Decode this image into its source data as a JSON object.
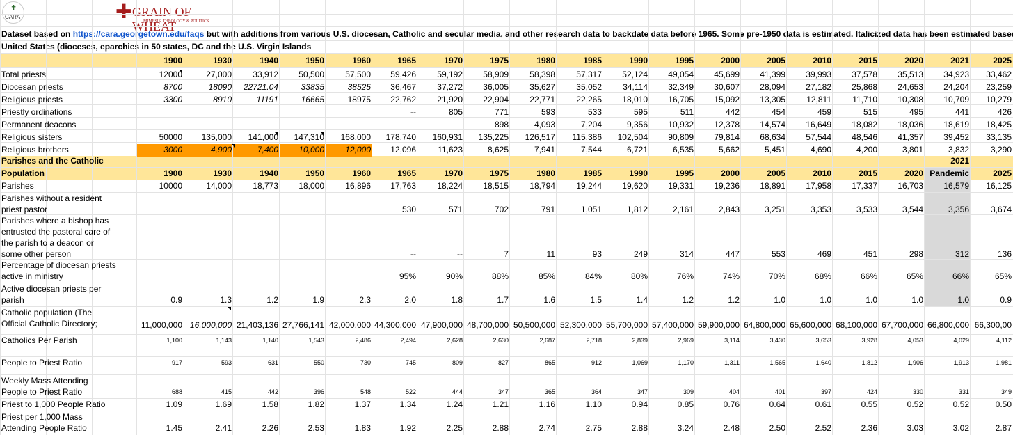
{
  "logos": {
    "cara_text": "CARA",
    "grain_title": "GRAIN OF WHEAT",
    "grain_sub": "MIMESIS, THEOLOGY & POLITICS"
  },
  "header": {
    "line1_pre": "Dataset based on ",
    "line1_link": "https://cara.georgetown.edu/faqs",
    "line1_post": " but with additions from various U.S. diocesan, Catholic and secular media, and other research data to backdate data before 1965. Some pre-1950 data is estimated. Italicized data has been estimated based on various",
    "line2": "United States (dioceses, eparchies in 50 states, DC and the U.S. Virgin Islands"
  },
  "years": [
    "1900",
    "1930",
    "1940",
    "1950",
    "1960",
    "1965",
    "1970",
    "1975",
    "1980",
    "1985",
    "1990",
    "1995",
    "2000",
    "2005",
    "2010",
    "2015",
    "2020",
    "2021",
    "2025"
  ],
  "years2": [
    "1900",
    "1930",
    "1940",
    "1950",
    "1960",
    "1965",
    "1970",
    "1975",
    "1980",
    "1985",
    "1990",
    "1995",
    "2000",
    "2005",
    "2010",
    "2015",
    "2020",
    "Pandemic",
    "2025"
  ],
  "section2": {
    "line1": "Parishes and the Catholic",
    "line2": "Population",
    "col2021": "2021"
  },
  "rows": [
    {
      "label": [
        "Total priests"
      ],
      "values": [
        "12000",
        "27,000",
        "33,912",
        "50,500",
        "57,500",
        "59,426",
        "59,192",
        "58,909",
        "58,398",
        "57,317",
        "52,124",
        "49,054",
        "45,699",
        "41,399",
        "39,993",
        "37,578",
        "35,513",
        "34,923",
        "33,462"
      ],
      "italic": []
    },
    {
      "label": [
        "Diocesan priests"
      ],
      "values": [
        "8700",
        "18090",
        "22721.04",
        "33835",
        "38525",
        "36,467",
        "37,272",
        "36,005",
        "35,627",
        "35,052",
        "34,114",
        "32,349",
        "30,607",
        "28,094",
        "27,182",
        "25,868",
        "24,653",
        "24,204",
        "23,259"
      ],
      "italic": [
        0,
        1,
        2,
        3,
        4
      ]
    },
    {
      "label": [
        "Religious priests"
      ],
      "values": [
        "3300",
        "8910",
        "11191",
        "16665",
        "18975",
        "22,762",
        "21,920",
        "22,904",
        "22,771",
        "22,265",
        "18,010",
        "16,705",
        "15,092",
        "13,305",
        "12,811",
        "11,710",
        "10,308",
        "10,709",
        "10,279"
      ],
      "italic": [
        0,
        1,
        2,
        3
      ]
    },
    {
      "label": [
        "Priestly ordinations"
      ],
      "values": [
        "",
        "",
        "",
        "",
        "",
        "--",
        "805",
        "771",
        "593",
        "533",
        "595",
        "511",
        "442",
        "454",
        "459",
        "515",
        "495",
        "441",
        "426"
      ],
      "italic": []
    },
    {
      "label": [
        "Permanent deacons"
      ],
      "values": [
        "",
        "",
        "",
        "",
        "",
        "",
        "",
        "898",
        "4,093",
        "7,204",
        "9,356",
        "10,932",
        "12,378",
        "14,574",
        "16,649",
        "18,082",
        "18,036",
        "18,619",
        "18,425"
      ],
      "italic": []
    },
    {
      "label": [
        "Religious sisters"
      ],
      "values": [
        "50000",
        "135,000",
        "141,000",
        "147,310",
        "168,000",
        "178,740",
        "160,931",
        "135,225",
        "126,517",
        "115,386",
        "102,504",
        "90,809",
        "79,814",
        "68,634",
        "57,544",
        "48,546",
        "41,357",
        "39,452",
        "33,135"
      ],
      "italic": []
    },
    {
      "label": [
        "Religious brothers"
      ],
      "values": [
        "3000",
        "4,900",
        "7,400",
        "10,000",
        "12,000",
        "12,096",
        "11,623",
        "8,625",
        "7,941",
        "7,544",
        "6,721",
        "6,535",
        "5,662",
        "5,451",
        "4,690",
        "4,200",
        "3,801",
        "3,832",
        "3,290"
      ],
      "italic": [
        0,
        1,
        2,
        3,
        4
      ]
    },
    {
      "label": [
        "Parishes"
      ],
      "values": [
        "10000",
        "14,000",
        "18,773",
        "18,000",
        "16,896",
        "17,763",
        "18,224",
        "18,515",
        "18,794",
        "19,244",
        "19,620",
        "19,331",
        "19,236",
        "18,891",
        "17,958",
        "17,337",
        "16,703",
        "16,579",
        "16,125"
      ],
      "italic": []
    },
    {
      "label": [
        "Parishes without a resident",
        "priest pastor"
      ],
      "values": [
        "",
        "",
        "",
        "",
        "",
        "530",
        "571",
        "702",
        "791",
        "1,051",
        "1,812",
        "2,161",
        "2,843",
        "3,251",
        "3,353",
        "3,533",
        "3,544",
        "3,356",
        "3,674"
      ],
      "italic": []
    },
    {
      "label": [
        "Parishes where a bishop has",
        "entrusted the pastoral care of",
        "the parish to a deacon or",
        "some other person"
      ],
      "values": [
        "",
        "",
        "",
        "",
        "",
        "--",
        "--",
        "7",
        "11",
        "93",
        "249",
        "314",
        "447",
        "553",
        "469",
        "451",
        "298",
        "312",
        "136"
      ],
      "italic": []
    },
    {
      "label": [
        "Percentage of diocesan priests",
        "active in ministry"
      ],
      "values": [
        "",
        "",
        "",
        "",
        "",
        "95%",
        "90%",
        "88%",
        "85%",
        "84%",
        "80%",
        "76%",
        "74%",
        "70%",
        "68%",
        "66%",
        "65%",
        "66%",
        "65%"
      ],
      "italic": []
    },
    {
      "label": [
        "Active diocesan priests per",
        "parish"
      ],
      "values": [
        "0.9",
        "1.3",
        "1.2",
        "1.9",
        "2.3",
        "2.0",
        "1.8",
        "1.7",
        "1.6",
        "1.5",
        "1.4",
        "1.2",
        "1.2",
        "1.0",
        "1.0",
        "1.0",
        "1.0",
        "1.0",
        "0.9"
      ],
      "italic": []
    },
    {
      "label": [
        "Catholic population (The",
        "Official Catholic Directory;"
      ],
      "values": [
        "11,000,000",
        "16,000,000",
        "21,403,136",
        "27,766,141",
        "42,000,000",
        "44,300,000",
        "47,900,000",
        "48,700,000",
        "50,500,000",
        "52,300,000",
        "55,700,000",
        "57,400,000",
        "59,900,000",
        "64,800,000",
        "65,600,000",
        "68,100,000",
        "67,700,000",
        "66,800,000",
        "66,300,00"
      ],
      "italic": [
        1
      ]
    },
    {
      "label": [
        "Catholics Per Parish"
      ],
      "values": [
        "1,100",
        "1,143",
        "1,140",
        "1,543",
        "2,486",
        "2,494",
        "2,628",
        "2,630",
        "2,687",
        "2,718",
        "2,839",
        "2,969",
        "3,114",
        "3,430",
        "3,653",
        "3,928",
        "4,053",
        "4,029",
        "4,112"
      ],
      "italic": []
    },
    {
      "label": [
        "People to Priest Ratio"
      ],
      "values": [
        "917",
        "593",
        "631",
        "550",
        "730",
        "745",
        "809",
        "827",
        "865",
        "912",
        "1,069",
        "1,170",
        "1,311",
        "1,565",
        "1,640",
        "1,812",
        "1,906",
        "1,913",
        "1,981"
      ],
      "italic": []
    },
    {
      "label": [
        "Weekly Mass Attending",
        "People to Priest Ratio"
      ],
      "values": [
        "688",
        "415",
        "442",
        "396",
        "548",
        "522",
        "444",
        "347",
        "365",
        "364",
        "347",
        "309",
        "404",
        "401",
        "397",
        "424",
        "330",
        "331",
        "349"
      ],
      "italic": []
    },
    {
      "label": [
        "Priest to 1,000 People Ratio"
      ],
      "values": [
        "1.09",
        "1.69",
        "1.58",
        "1.82",
        "1.37",
        "1.34",
        "1.24",
        "1.21",
        "1.16",
        "1.10",
        "0.94",
        "0.85",
        "0.76",
        "0.64",
        "0.61",
        "0.55",
        "0.52",
        "0.52",
        "0.50"
      ],
      "italic": []
    },
    {
      "label": [
        "Priest per 1,000 Mass",
        "Attending People Ratio"
      ],
      "values": [
        "1.45",
        "2.41",
        "2.26",
        "2.53",
        "1.83",
        "1.92",
        "2.25",
        "2.88",
        "2.74",
        "2.75",
        "2.88",
        "3.24",
        "2.48",
        "2.50",
        "2.52",
        "2.36",
        "3.03",
        "3.02",
        "2.87"
      ],
      "italic": []
    }
  ]
}
